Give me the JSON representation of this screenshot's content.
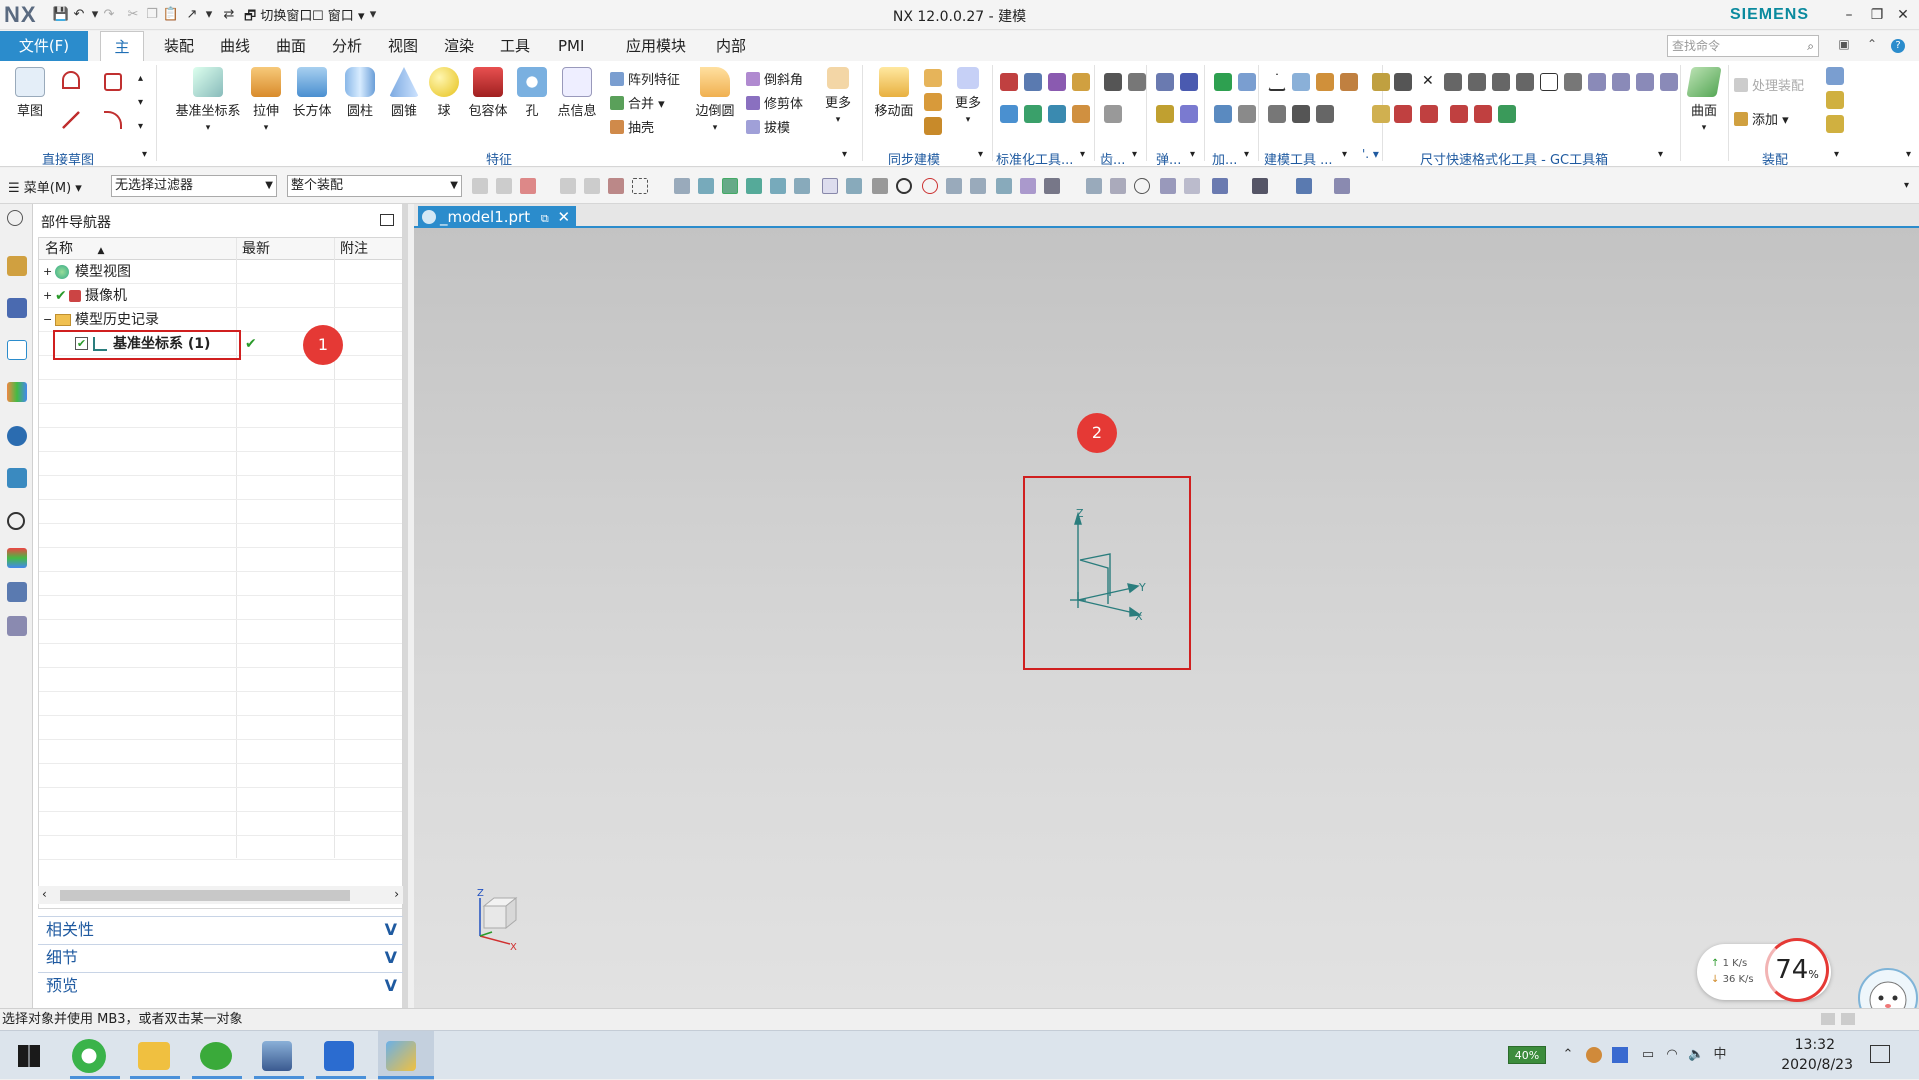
{
  "titlebar": {
    "logo": "NX",
    "switch_window": "切换窗口",
    "window_menu": "窗口",
    "title": "NX 12.0.0.27 - 建模",
    "brand": "SIEMENS"
  },
  "tabs": {
    "file": "文件(F)",
    "items": [
      "主页",
      "装配",
      "曲线",
      "曲面",
      "分析",
      "视图",
      "渲染",
      "工具",
      "PMI",
      "应用模块",
      "内部"
    ],
    "active": "主页",
    "search_placeholder": "查找命令"
  },
  "ribbon": {
    "sketch": "草图",
    "direct_sketch_group": "直接草图",
    "datum_csys": "基准坐标系",
    "extrude": "拉伸",
    "block": "长方体",
    "cylinder": "圆柱",
    "cone": "圆锥",
    "sphere": "球",
    "wrap": "包容体",
    "hole": "孔",
    "point_info": "点信息",
    "pattern_feature": "阵列特征",
    "unite": "合并",
    "shell": "抽壳",
    "edge_blend": "边倒圆",
    "chamfer": "倒斜角",
    "trim_body": "修剪体",
    "draft": "拔模",
    "more1": "更多",
    "feature_group": "特征",
    "move_face": "移动面",
    "more2": "更多",
    "sync_group": "同步建模",
    "std_tools_group": "标准化工具...",
    "gear_group": "齿...",
    "spring_group": "弹...",
    "add_group": "加...",
    "model_tools_group": "建模工具 ...",
    "dim_group": "尺寸快速格式化工具 - GC工具箱",
    "surface": "曲面",
    "process_assembly": "处理装配",
    "add": "添加",
    "assembly_group": "装配"
  },
  "selection_bar": {
    "menu": "菜单(M)",
    "filter": "无选择过滤器",
    "scope": "整个装配"
  },
  "navigator": {
    "title": "部件导航器",
    "columns": [
      "名称",
      "最新",
      "附注"
    ],
    "rows": [
      {
        "expander": "+",
        "label": "模型视图"
      },
      {
        "expander": "+",
        "label": "摄像机"
      },
      {
        "expander": "−",
        "label": "模型历史记录"
      },
      {
        "expander": "",
        "label": "基准坐标系 (1)",
        "latest": "✔"
      }
    ],
    "sections": [
      "相关性",
      "细节",
      "预览"
    ]
  },
  "document": {
    "tab_label": "_model1.prt"
  },
  "callouts": [
    "1",
    "2"
  ],
  "axes": {
    "z": "Z",
    "y": "Y",
    "x": "X"
  },
  "status": "选择对象并使用 MB3，或者双击某一对象",
  "netwidget": {
    "up": "1 K/s",
    "down": "36 K/s",
    "percent": "74",
    "pct_sign": "%"
  },
  "taskbar": {
    "battery": "40%",
    "time": "13:32",
    "date": "2020/8/23"
  },
  "colors": {
    "accent": "#2b8ccc",
    "callout_red": "#e53935",
    "datum_teal": "#2a7d7d"
  }
}
